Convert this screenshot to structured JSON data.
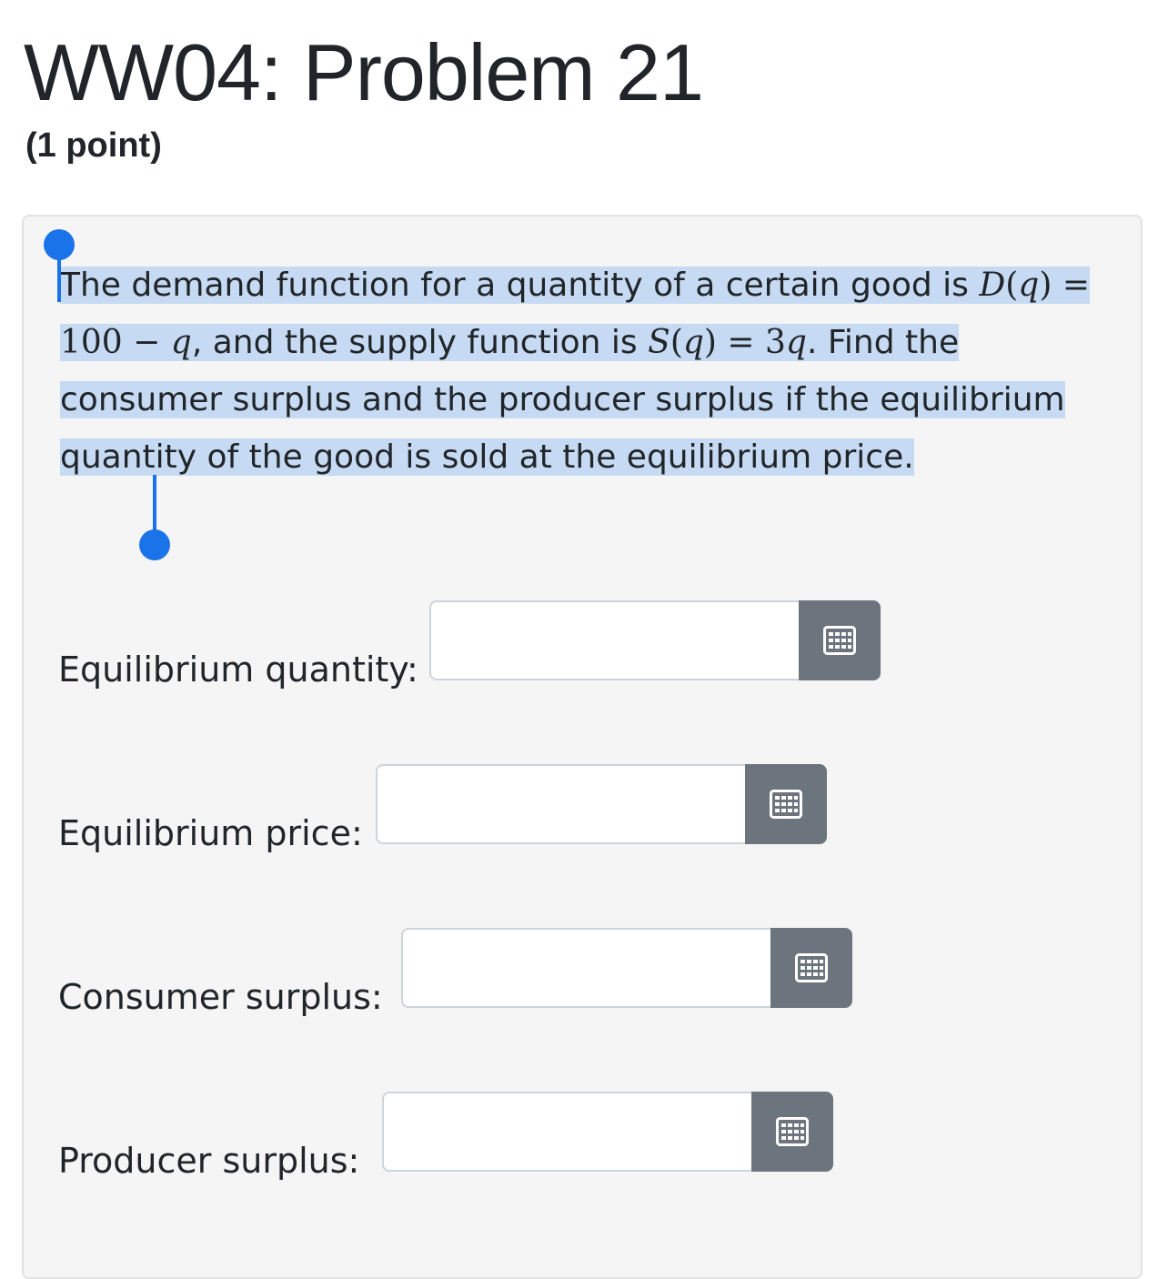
{
  "page": {
    "title": "WW04: Problem 21",
    "points": "(1 point)"
  },
  "problem": {
    "text_intro": "The demand function for a quantity of a certain good is",
    "demand_fn": "D(q) = 100 − q",
    "text_mid": ", and the supply function is",
    "supply_fn": "S(q) = 3q",
    "text_end": ". Find the consumer surplus and the producer surplus if the equilibrium quantity of the good is sold at the equilibrium price."
  },
  "answers": [
    {
      "label": "Equilibrium quantity:",
      "value": "",
      "icon": "keyboard-icon"
    },
    {
      "label": "Equilibrium price:",
      "value": "",
      "icon": "keyboard-icon"
    },
    {
      "label": "Consumer surplus:",
      "value": "",
      "icon": "keyboard-icon"
    },
    {
      "label": "Producer surplus:",
      "value": "",
      "icon": "keyboard-icon"
    }
  ],
  "colors": {
    "selection": "#c6dbf3",
    "cursor": "#1a73e8",
    "button": "#6c757d",
    "card": "#f5f5f5"
  }
}
